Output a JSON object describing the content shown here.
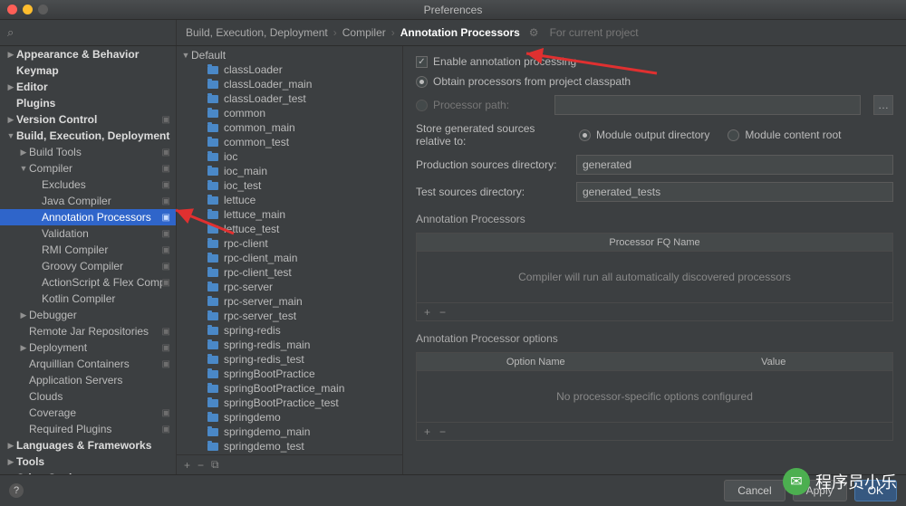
{
  "title": "Preferences",
  "search_placeholder": "",
  "breadcrumbs": [
    "Build, Execution, Deployment",
    "Compiler",
    "Annotation Processors"
  ],
  "context_hint": "For current project",
  "sidebar": [
    {
      "label": "Appearance & Behavior",
      "depth": 0,
      "arrow": "▶",
      "bold": true,
      "badge": false
    },
    {
      "label": "Keymap",
      "depth": 0,
      "arrow": "",
      "bold": true,
      "badge": false
    },
    {
      "label": "Editor",
      "depth": 0,
      "arrow": "▶",
      "bold": true,
      "badge": false
    },
    {
      "label": "Plugins",
      "depth": 0,
      "arrow": "",
      "bold": true,
      "badge": false
    },
    {
      "label": "Version Control",
      "depth": 0,
      "arrow": "▶",
      "bold": true,
      "badge": true
    },
    {
      "label": "Build, Execution, Deployment",
      "depth": 0,
      "arrow": "▼",
      "bold": true,
      "badge": false
    },
    {
      "label": "Build Tools",
      "depth": 1,
      "arrow": "▶",
      "bold": false,
      "badge": true
    },
    {
      "label": "Compiler",
      "depth": 1,
      "arrow": "▼",
      "bold": false,
      "badge": true
    },
    {
      "label": "Excludes",
      "depth": 2,
      "arrow": "",
      "bold": false,
      "badge": true
    },
    {
      "label": "Java Compiler",
      "depth": 2,
      "arrow": "",
      "bold": false,
      "badge": true
    },
    {
      "label": "Annotation Processors",
      "depth": 2,
      "arrow": "",
      "bold": false,
      "badge": true,
      "selected": true
    },
    {
      "label": "Validation",
      "depth": 2,
      "arrow": "",
      "bold": false,
      "badge": true
    },
    {
      "label": "RMI Compiler",
      "depth": 2,
      "arrow": "",
      "bold": false,
      "badge": true
    },
    {
      "label": "Groovy Compiler",
      "depth": 2,
      "arrow": "",
      "bold": false,
      "badge": true
    },
    {
      "label": "ActionScript & Flex Compiler",
      "depth": 2,
      "arrow": "",
      "bold": false,
      "badge": true
    },
    {
      "label": "Kotlin Compiler",
      "depth": 2,
      "arrow": "",
      "bold": false,
      "badge": false
    },
    {
      "label": "Debugger",
      "depth": 1,
      "arrow": "▶",
      "bold": false,
      "badge": false
    },
    {
      "label": "Remote Jar Repositories",
      "depth": 1,
      "arrow": "",
      "bold": false,
      "badge": true
    },
    {
      "label": "Deployment",
      "depth": 1,
      "arrow": "▶",
      "bold": false,
      "badge": true
    },
    {
      "label": "Arquillian Containers",
      "depth": 1,
      "arrow": "",
      "bold": false,
      "badge": true
    },
    {
      "label": "Application Servers",
      "depth": 1,
      "arrow": "",
      "bold": false,
      "badge": false
    },
    {
      "label": "Clouds",
      "depth": 1,
      "arrow": "",
      "bold": false,
      "badge": false
    },
    {
      "label": "Coverage",
      "depth": 1,
      "arrow": "",
      "bold": false,
      "badge": true
    },
    {
      "label": "Required Plugins",
      "depth": 1,
      "arrow": "",
      "bold": false,
      "badge": true
    },
    {
      "label": "Languages & Frameworks",
      "depth": 0,
      "arrow": "▶",
      "bold": true,
      "badge": false
    },
    {
      "label": "Tools",
      "depth": 0,
      "arrow": "▶",
      "bold": true,
      "badge": false
    },
    {
      "label": "Other Settings",
      "depth": 0,
      "arrow": "▶",
      "bold": true,
      "badge": false
    }
  ],
  "profile_root": "Default",
  "profiles": [
    "classLoader",
    "classLoader_main",
    "classLoader_test",
    "common",
    "common_main",
    "common_test",
    "ioc",
    "ioc_main",
    "ioc_test",
    "lettuce",
    "lettuce_main",
    "lettuce_test",
    "rpc-client",
    "rpc-client_main",
    "rpc-client_test",
    "rpc-server",
    "rpc-server_main",
    "rpc-server_test",
    "spring-redis",
    "spring-redis_main",
    "spring-redis_test",
    "springBootPractice",
    "springBootPractice_main",
    "springBootPractice_test",
    "springdemo",
    "springdemo_main",
    "springdemo_test"
  ],
  "settings": {
    "enable_label": "Enable annotation processing",
    "obtain_label": "Obtain processors from project classpath",
    "path_label": "Processor path:",
    "store_label": "Store generated sources relative to:",
    "store_opt1": "Module output directory",
    "store_opt2": "Module content root",
    "prod_label": "Production sources directory:",
    "prod_value": "generated",
    "test_label": "Test sources directory:",
    "test_value": "generated_tests",
    "proc_title": "Annotation Processors",
    "proc_col": "Processor FQ Name",
    "proc_empty": "Compiler will run all automatically discovered processors",
    "opt_title": "Annotation Processor options",
    "opt_col1": "Option Name",
    "opt_col2": "Value",
    "opt_empty": "No processor-specific options configured"
  },
  "buttons": {
    "cancel": "Cancel",
    "apply": "Apply",
    "ok": "OK"
  },
  "watermark": "程序员小乐"
}
